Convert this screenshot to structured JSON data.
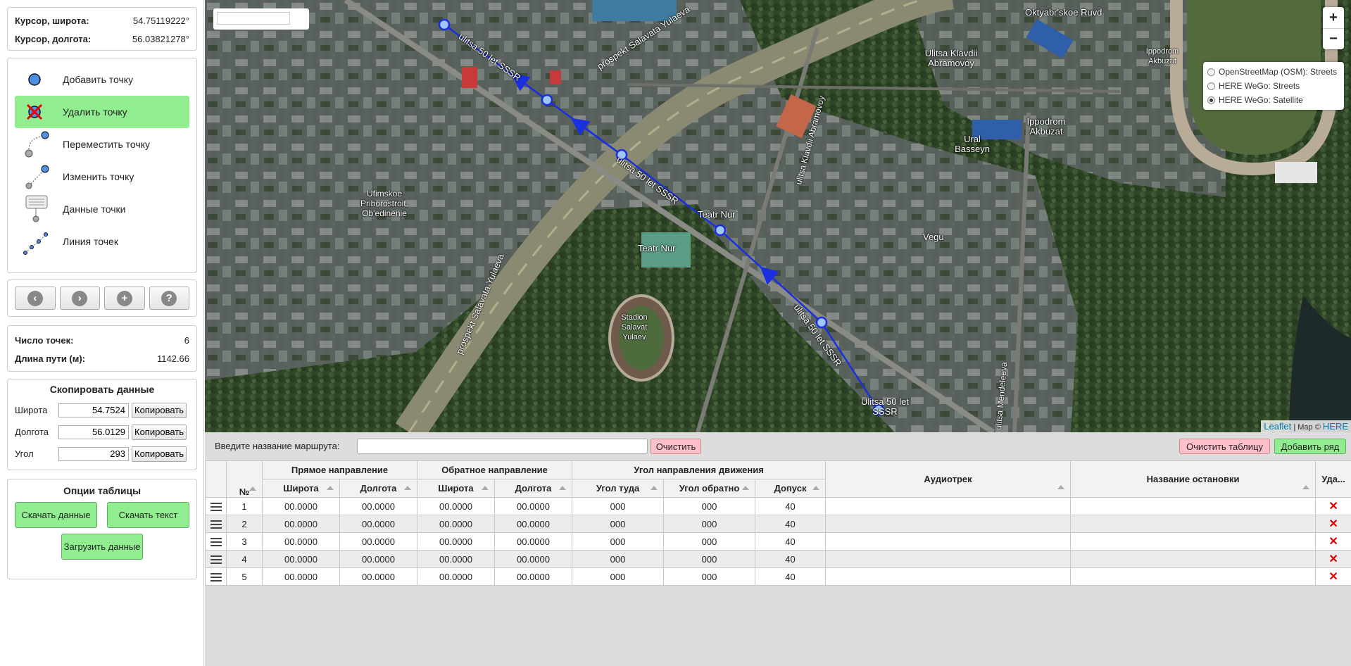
{
  "cursor": {
    "lat_label": "Курсор, широта:",
    "lat_value": "54.75119222°",
    "lon_label": "Курсор, долгота:",
    "lon_value": "56.03821278°"
  },
  "tools": [
    {
      "label": "Добавить точку",
      "icon": "add-point-icon"
    },
    {
      "label": "Удалить точку",
      "icon": "delete-point-icon"
    },
    {
      "label": "Переместить точку",
      "icon": "move-point-icon"
    },
    {
      "label": "Изменить точку",
      "icon": "edit-point-icon"
    },
    {
      "label": "Данные точки",
      "icon": "point-data-icon"
    },
    {
      "label": "Линия точек",
      "icon": "point-line-icon"
    }
  ],
  "nav_buttons": [
    {
      "icon": "arrow-left-icon",
      "glyph": "‹"
    },
    {
      "icon": "arrow-right-icon",
      "glyph": "›"
    },
    {
      "icon": "plus-icon",
      "glyph": "+"
    },
    {
      "icon": "help-icon",
      "glyph": "?"
    }
  ],
  "stats": {
    "points_label": "Число точек:",
    "points_value": "6",
    "length_label": "Длина пути (м):",
    "length_value": "1142.66"
  },
  "copy": {
    "title": "Скопировать данные",
    "rows": [
      {
        "label": "Широта",
        "value": "54.7524",
        "button": "Копировать"
      },
      {
        "label": "Долгота",
        "value": "56.0129",
        "button": "Копировать"
      },
      {
        "label": "Угол",
        "value": "293",
        "button": "Копировать"
      }
    ]
  },
  "table_options": {
    "title": "Опции таблицы",
    "download_data": "Скачать данные",
    "download_text": "Скачать текст",
    "upload_data": "Загрузить данные"
  },
  "map": {
    "labels": [
      "Oktyabr'skoe Ruvd",
      "Ulitsa Klavdii Abramovoy",
      "Ippodrom Akbuzat",
      "Ippodrom Akbuzat",
      "Ural Basseyn",
      "Vegu",
      "Teatr Nur",
      "Teatr Nur",
      "Ufimskoe Priborostroit. Ob'edinenie",
      "Stadion Salavat Yulaev",
      "Ulitsa 50 let SSSR",
      "prospekt Salavata Yulaeva",
      "prospekt Salavata Yulaeva",
      "ulitsa 50 let SSSR",
      "ulitsa 50 let SSSR",
      "ulitsa 50 let SSSR",
      "ulitsa Mendeleeva",
      "ulitsa Klavdii Abramovoy"
    ],
    "layers": [
      {
        "label": "OpenStreetMap (OSM): Streets",
        "checked": false
      },
      {
        "label": "HERE WeGo: Streets",
        "checked": false
      },
      {
        "label": "HERE WeGo: Satellite",
        "checked": true
      }
    ],
    "zoom_in": "+",
    "zoom_out": "−",
    "attribution": {
      "leaflet": "Leaflet",
      "sep": " | Map © ",
      "here": "HERE"
    },
    "route_color": "#1a2fe0"
  },
  "route_bar": {
    "name_label": "Введите название маршрута:",
    "name_value": "",
    "clear": "Очистить",
    "clear_table": "Очистить таблицу",
    "add_row": "Добавить ряд"
  },
  "table": {
    "groups": [
      "Прямое направление",
      "Обратное направление",
      "Угол направления движения"
    ],
    "columns": [
      "№",
      "Широта",
      "Долгота",
      "Широта",
      "Долгота",
      "Угол туда",
      "Угол обратно",
      "Допуск",
      "Аудиотрек",
      "Название остановки",
      "Уда..."
    ],
    "rows": [
      {
        "n": "1",
        "lat1": "00.0000",
        "lon1": "00.0000",
        "lat2": "00.0000",
        "lon2": "00.0000",
        "a1": "000",
        "a2": "000",
        "tol": "40",
        "audio": "",
        "stop": ""
      },
      {
        "n": "2",
        "lat1": "00.0000",
        "lon1": "00.0000",
        "lat2": "00.0000",
        "lon2": "00.0000",
        "a1": "000",
        "a2": "000",
        "tol": "40",
        "audio": "",
        "stop": ""
      },
      {
        "n": "3",
        "lat1": "00.0000",
        "lon1": "00.0000",
        "lat2": "00.0000",
        "lon2": "00.0000",
        "a1": "000",
        "a2": "000",
        "tol": "40",
        "audio": "",
        "stop": ""
      },
      {
        "n": "4",
        "lat1": "00.0000",
        "lon1": "00.0000",
        "lat2": "00.0000",
        "lon2": "00.0000",
        "a1": "000",
        "a2": "000",
        "tol": "40",
        "audio": "",
        "stop": ""
      },
      {
        "n": "5",
        "lat1": "00.0000",
        "lon1": "00.0000",
        "lat2": "00.0000",
        "lon2": "00.0000",
        "a1": "000",
        "a2": "000",
        "tol": "40",
        "audio": "",
        "stop": ""
      }
    ],
    "delete_glyph": "✕"
  }
}
